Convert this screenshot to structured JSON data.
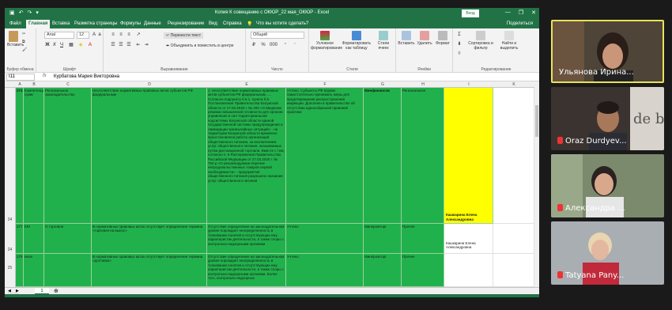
{
  "window": {
    "title": "Копия К совещанию с ОКЮР_22 мая_ОКЮР - Excel",
    "sign_in": "Вход",
    "minimize": "—",
    "restore": "❐",
    "close": "✕"
  },
  "menu": {
    "tabs": [
      "Файл",
      "Главная",
      "Вставка",
      "Разметка страницы",
      "Формулы",
      "Данные",
      "Рецензирование",
      "Вид",
      "Справка"
    ],
    "active_tab": "Главная",
    "tell_me": "Что вы хотите сделать?",
    "share": "Поделиться"
  },
  "ribbon": {
    "clipboard": {
      "paste": "Вставить",
      "label": "Буфер обмена"
    },
    "font": {
      "name": "Arial",
      "size": "12",
      "label": "Шрифт"
    },
    "alignment": {
      "wrap": "Перенести текст",
      "merge": "Объединить и поместить в центре",
      "label": "Выравнивание"
    },
    "number": {
      "format": "Общий",
      "label": "Число"
    },
    "styles": {
      "conditional": "Условное форматирование",
      "as_table": "Форматировать как таблицу",
      "cell_styles": "Стили ячеек",
      "label": "Стили"
    },
    "cells": {
      "insert": "Вставить",
      "delete": "Удалить",
      "format": "Формат",
      "label": "Ячейки"
    },
    "editing": {
      "sort": "Сортировка и фильтр",
      "find": "Найти и выделить",
      "label": "Редактирование"
    }
  },
  "formula_bar": {
    "name_box": "I11",
    "fx": "fx",
    "value": "Курбатова Мария Викторовна"
  },
  "columns": [
    "A",
    "B",
    "C",
    "D",
    "E",
    "F",
    "G",
    "H",
    "I",
    "J",
    "K"
  ],
  "rows": [
    {
      "num": "24",
      "a": "274",
      "b": "Компетенции сумм",
      "c": "Региональное законодательство",
      "d": "Несоответствие нормативных правовых актов субъектов РФ федеральным",
      "e": "1.     Несоответствие нормативных правовых актов субъектов РФ федеральным .....   Согласно подпункту б.5.1. пункта б.5. Постановления Правительства Калужской области от 17.03.2020 г. № 200 «О введении режима повышенной готовности для органов управления и сил территориальной подсистемы Калужской области единой государственной системы предупреждения и ликвидации чрезвычайных ситуаций» - на территории Калужской области временно приостановлена работа организаций общественного питания, за исключением услуг общественного питания, оказываемых путем дистанционной торговли. Вместе с тем, согласно п. 6 Распоряжения Правительства Российской Федерации от 27.03.2020 г. № 762-р «О рекомендуемом перечне непродовольственных товаров первой необходимости» - предприятия общественного питания разрешено оказание услуг общественного питания",
      "f": "Учтено. Субъекты РФ вправе самостоятельно принимать меры для предотвращения распространения инфекции. Дополнен в правительство об отсутствии единообразной правовой практики",
      "g": "Минфинансов",
      "h": "Региональное",
      "i": "",
      "i_name": "Кашкарина Елена Александровна"
    },
    {
      "num": "24",
      "a": "277",
      "b": "КЮ",
      "c": "О торговле",
      "d": "В нормативных правовых актах отсутствует определение термина «торговля на вынос»",
      "e": "Отсутствие определения на законодательном уровне порождает неопределенность в толковании понятия и отсутствующих ему характеристик деятельности, а также споры с контрольно-надзорными органами",
      "f": "Учтено",
      "g": "Минпромторг",
      "h": "Прочее",
      "i": "",
      "i_name": "Кашкарина Елена Александровна"
    },
    {
      "num": "25",
      "a": "279",
      "b": "иное",
      "c": "",
      "d": "В нормативных правовых актах отсутствует определение термина «доставка»",
      "e": "Отсутствие определения на законодательном уровне порождает неопределенность в толковании понятия и отсутствующих ему характеристик деятельности, а также споры с контрольно-надзорными органами. Более того, контрольно-надзорных",
      "f": "Учтено",
      "g": "Минпромторг",
      "h": "Прочее",
      "i": "",
      "i_name": ""
    }
  ],
  "sheet_tab": "1",
  "status": "Готово",
  "participants": [
    {
      "name": "Ульянова Ирина...",
      "bg": "#5a4a3a",
      "active": true
    },
    {
      "name": "Oraz Durdyev...",
      "bg": "#3b3330",
      "active": false
    },
    {
      "name": "Александра ...",
      "bg": "#6b7a5f",
      "active": false
    },
    {
      "name": "Tatyana Pany...",
      "bg": "#9da3a8",
      "active": false
    }
  ],
  "colors": {
    "excel_green": "#217346",
    "cell_green": "#21b14c",
    "cell_yellow": "#ffff00",
    "active_border": "#e7e35a"
  }
}
